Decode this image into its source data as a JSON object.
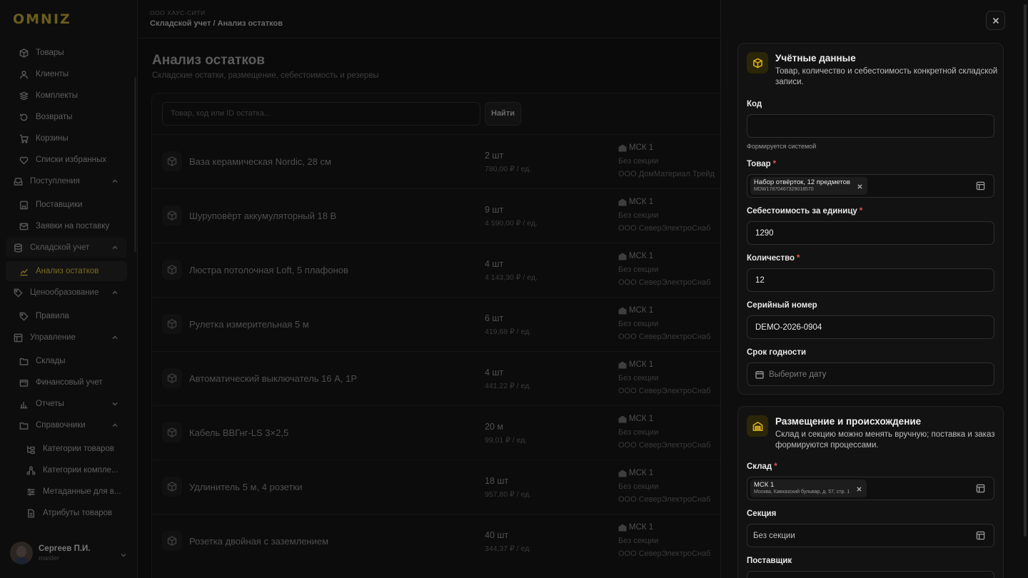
{
  "sidebar": {
    "logo": "OMNIZ",
    "items": [
      {
        "label": "Товары",
        "icon": "box-icon"
      },
      {
        "label": "Клиенты",
        "icon": "user-icon"
      },
      {
        "label": "Комплекты",
        "icon": "layers-icon"
      },
      {
        "label": "Возвраты",
        "icon": "undo-icon"
      },
      {
        "label": "Корзины",
        "icon": "cart-icon"
      },
      {
        "label": "Списки избранных",
        "icon": "heart-icon"
      },
      {
        "label": "Поступления",
        "icon": "inbox-icon"
      },
      {
        "label": "Поставщики",
        "icon": "store-icon"
      },
      {
        "label": "Заявки на поставку",
        "icon": "mail-icon"
      },
      {
        "label": "Складской учет",
        "icon": "database-icon"
      },
      {
        "label": "Анализ остатков",
        "icon": "chart-icon"
      },
      {
        "label": "Ценообразование",
        "icon": "tag-icon"
      },
      {
        "label": "Правила",
        "icon": "tag-icon"
      },
      {
        "label": "Управление",
        "icon": "table-icon"
      },
      {
        "label": "Склады",
        "icon": "folder-icon"
      },
      {
        "label": "Финансовый учет",
        "icon": "wallet-icon"
      },
      {
        "label": "Отчеты",
        "icon": "bar-chart-icon"
      },
      {
        "label": "Справочники",
        "icon": "folder-icon"
      },
      {
        "label": "Категории товаров",
        "icon": "tree-icon"
      },
      {
        "label": "Категории компле...",
        "icon": "network-icon"
      },
      {
        "label": "Метаданные для в...",
        "icon": "sliders-icon"
      },
      {
        "label": "Атрибуты товаров",
        "icon": "file-icon"
      }
    ],
    "user": {
      "name": "Сергеев П.И.",
      "role": "master"
    }
  },
  "header": {
    "org": "ООО ХАУС-СИТИ",
    "breadcrumb": "Складской учет / Анализ остатков"
  },
  "main": {
    "title": "Анализ остатков",
    "subtitle": "Складские остатки, размещение, себестоимость и резервы",
    "search_placeholder": "Товар, код или ID остатка...",
    "find_label": "Найти",
    "rows": [
      {
        "name": "Ваза керамическая Nordic, 28 см",
        "qty": "2 шт",
        "price": "780,00 ₽ / ед.",
        "warehouse": "МСК 1",
        "section": "Без секции",
        "supplier": "ООО ДомМатериал Трейд"
      },
      {
        "name": "Шуруповёрт аккумуляторный 18 В",
        "qty": "9 шт",
        "price": "4 590,00 ₽ / ед.",
        "warehouse": "МСК 1",
        "section": "Без секции",
        "supplier": "ООО СеверЭлектроСнаб"
      },
      {
        "name": "Люстра потолочная Loft, 5 плафонов",
        "qty": "4 шт",
        "price": "4 143,30 ₽ / ед.",
        "warehouse": "МСК 1",
        "section": "Без секции",
        "supplier": "ООО СеверЭлектроСнаб"
      },
      {
        "name": "Рулетка измерительная 5 м",
        "qty": "6 шт",
        "price": "419,69 ₽ / ед.",
        "warehouse": "МСК 1",
        "section": "Без секции",
        "supplier": "ООО СеверЭлектроСнаб"
      },
      {
        "name": "Автоматический выключатель 16 А, 1P",
        "qty": "4 шт",
        "price": "441,22 ₽ / ед.",
        "warehouse": "МСК 1",
        "section": "Без секции",
        "supplier": "ООО СеверЭлектроСнаб"
      },
      {
        "name": "Кабель ВВГнг-LS 3×2,5",
        "qty": "20 м",
        "price": "99,01 ₽ / ед.",
        "warehouse": "МСК 1",
        "section": "Без секции",
        "supplier": "ООО СеверЭлектроСнаб"
      },
      {
        "name": "Удлинитель 5 м, 4 розетки",
        "qty": "18 шт",
        "price": "957,80 ₽ / ед.",
        "warehouse": "МСК 1",
        "section": "Без секции",
        "supplier": "ООО СеверЭлектроСнаб"
      },
      {
        "name": "Розетка двойная с заземлением",
        "qty": "40 шт",
        "price": "344,37 ₽ / ед.",
        "warehouse": "МСК 1",
        "section": "Без секции",
        "supplier": "ООО СеверЭлектроСнаб"
      }
    ]
  },
  "drawer": {
    "accounting": {
      "title": "Учётные данные",
      "desc": "Товар, количество и себестоимость конкретной складской записи.",
      "code_label": "Код",
      "code_value": "",
      "code_hint": "Формируется системой",
      "product_label": "Товар",
      "product_name": "Набор отвёрток, 12 предметов",
      "product_code": "MDW17870467329018570",
      "cost_label": "Себестоимость за единицу",
      "cost_value": "1290",
      "qty_label": "Количество",
      "qty_value": "12",
      "serial_label": "Серийный номер",
      "serial_value": "DEMO-2026-0904",
      "expiry_label": "Срок годности",
      "expiry_placeholder": "Выберите дату"
    },
    "placement": {
      "title": "Размещение и происхождение",
      "desc": "Склад и секцию можно менять вручную; поставка и заказ формируются процессами.",
      "warehouse_label": "Склад",
      "warehouse_name": "МСК 1",
      "warehouse_address": "Москва, Кавказский бульвар, д. 57, стр. 1",
      "section_label": "Секция",
      "section_value": "Без секции",
      "supplier_label": "Поставщик"
    }
  },
  "colors": {
    "accent": "#e0b320",
    "required": "#e25555"
  }
}
